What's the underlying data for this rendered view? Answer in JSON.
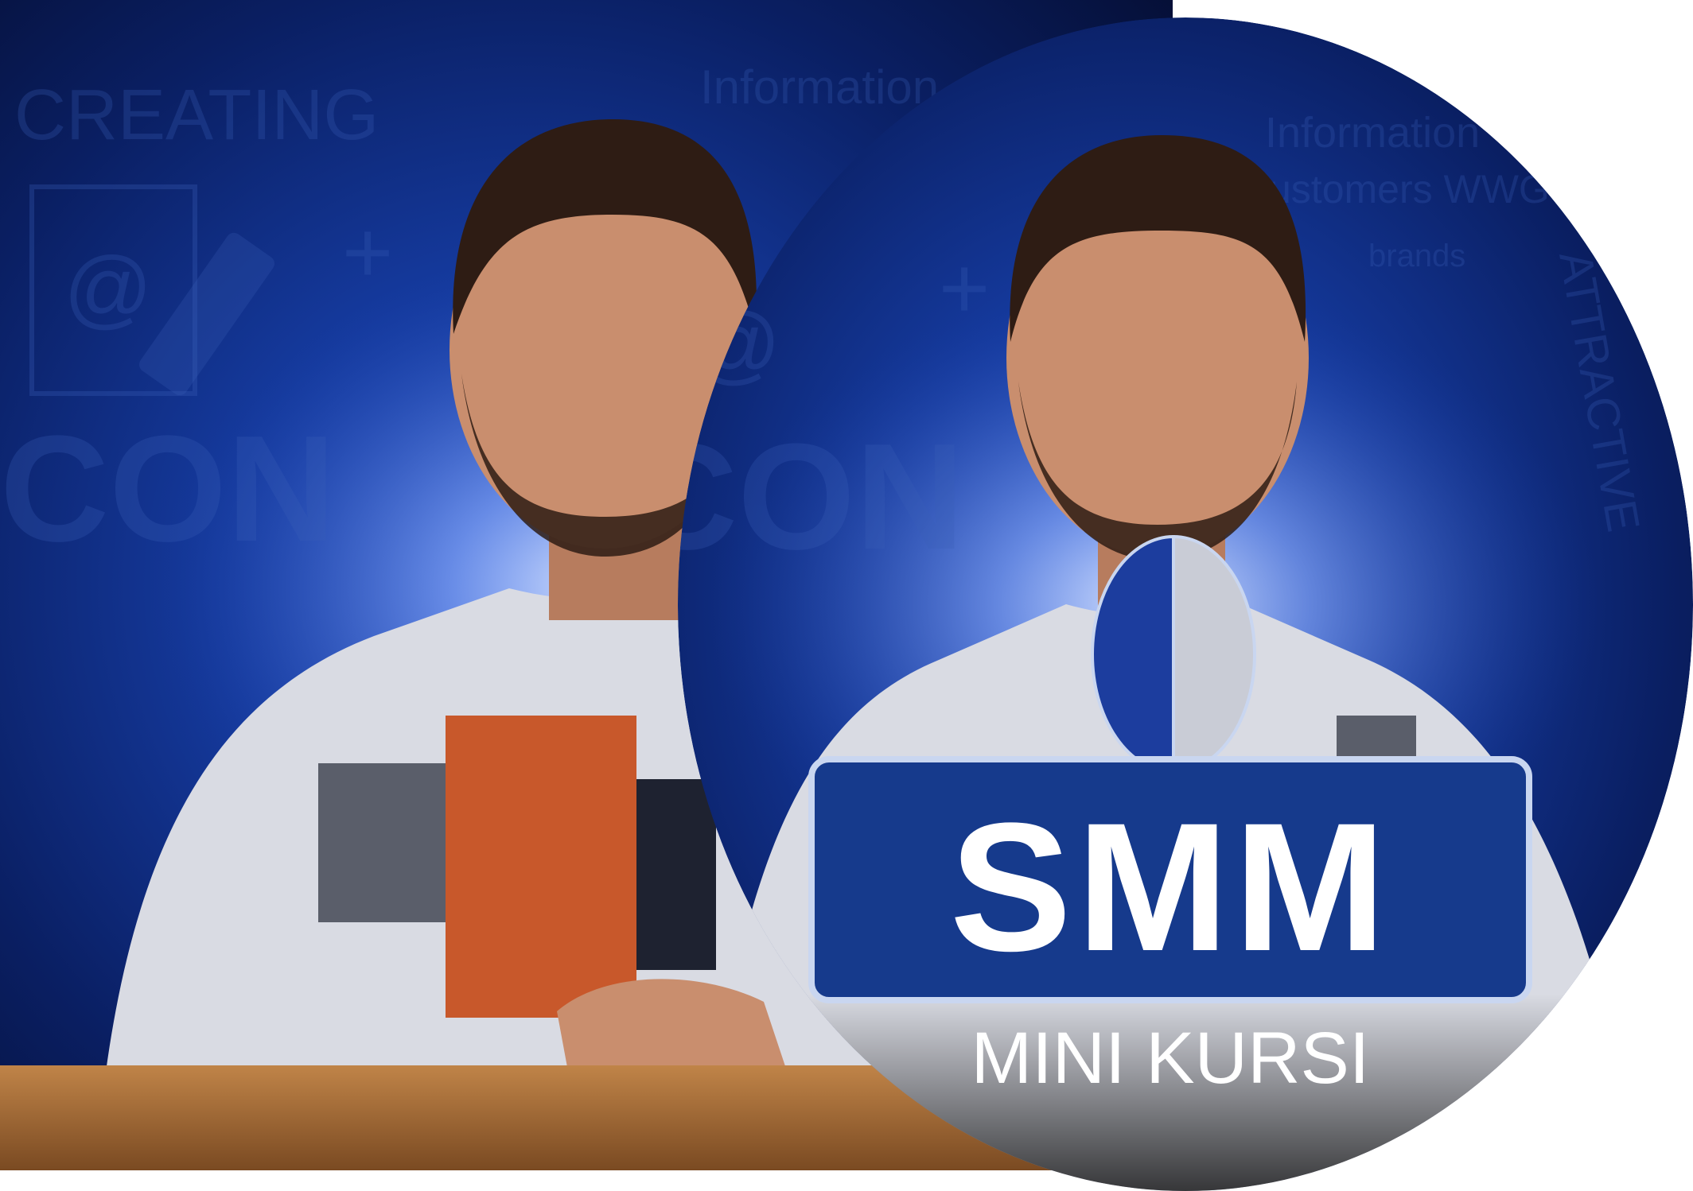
{
  "background_words": {
    "creating": "CREATING",
    "con": "CON",
    "information": "Information",
    "customers": "customers WWG",
    "brands": "brands",
    "attractive": "ATTRACTIVE"
  },
  "badge": {
    "title": "SMM",
    "subtitle": "MINI KURSI"
  },
  "colors": {
    "deep_navy": "#06123f",
    "royal_blue": "#1a3fa8",
    "glow": "#bcd4ff",
    "badge_blue": "#163a8c",
    "badge_border": "#c9d6f0",
    "sweater": "#d9dbe3",
    "logo_orange": "#c8582b",
    "skin": "#c98e6e",
    "hair": "#2e1c14",
    "table_wood": "#b07538"
  }
}
